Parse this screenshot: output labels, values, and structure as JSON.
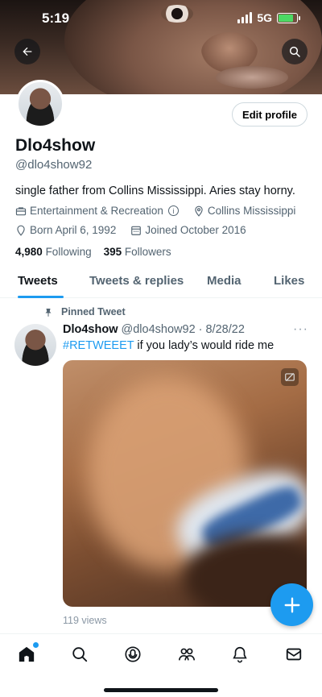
{
  "status_bar": {
    "time": "5:19",
    "network": "5G",
    "battery_level": 0.8,
    "battery_color": "#4cd964"
  },
  "header": {
    "back_icon": "arrow-left-icon",
    "search_icon": "search-icon"
  },
  "profile": {
    "edit_button_label": "Edit profile",
    "name": "Dlo4show",
    "handle": "@dlo4show92",
    "bio": "single father from Collins Mississippi. Aries stay horny.",
    "category": "Entertainment & Recreation",
    "category_info_icon": "i",
    "location": "Collins Mississippi",
    "birthday": "Born April 6, 1992",
    "joined": "Joined October 2016",
    "following_count": "4,980",
    "following_label": "Following",
    "followers_count": "395",
    "followers_label": "Followers"
  },
  "tabs": [
    {
      "label": "Tweets",
      "active": true
    },
    {
      "label": "Tweets & replies",
      "active": false
    },
    {
      "label": "Media",
      "active": false
    },
    {
      "label": "Likes",
      "active": false
    }
  ],
  "pinned_tweet": {
    "pinned_label": "Pinned Tweet",
    "author_name": "Dlo4show",
    "author_meta": "@dlo4show92 · 8/28/22",
    "more_label": "···",
    "hashtag": "#RETWEEET",
    "text": " if you lady’s would ride me",
    "views": "119 views"
  },
  "fab": {
    "icon": "plus-icon"
  },
  "bottom_nav": [
    "home-icon",
    "search-icon",
    "spaces-icon",
    "communities-icon",
    "notifications-icon",
    "messages-icon"
  ],
  "colors": {
    "accent": "#1d9bf0",
    "text": "#0f1419",
    "secondary": "#536471"
  }
}
